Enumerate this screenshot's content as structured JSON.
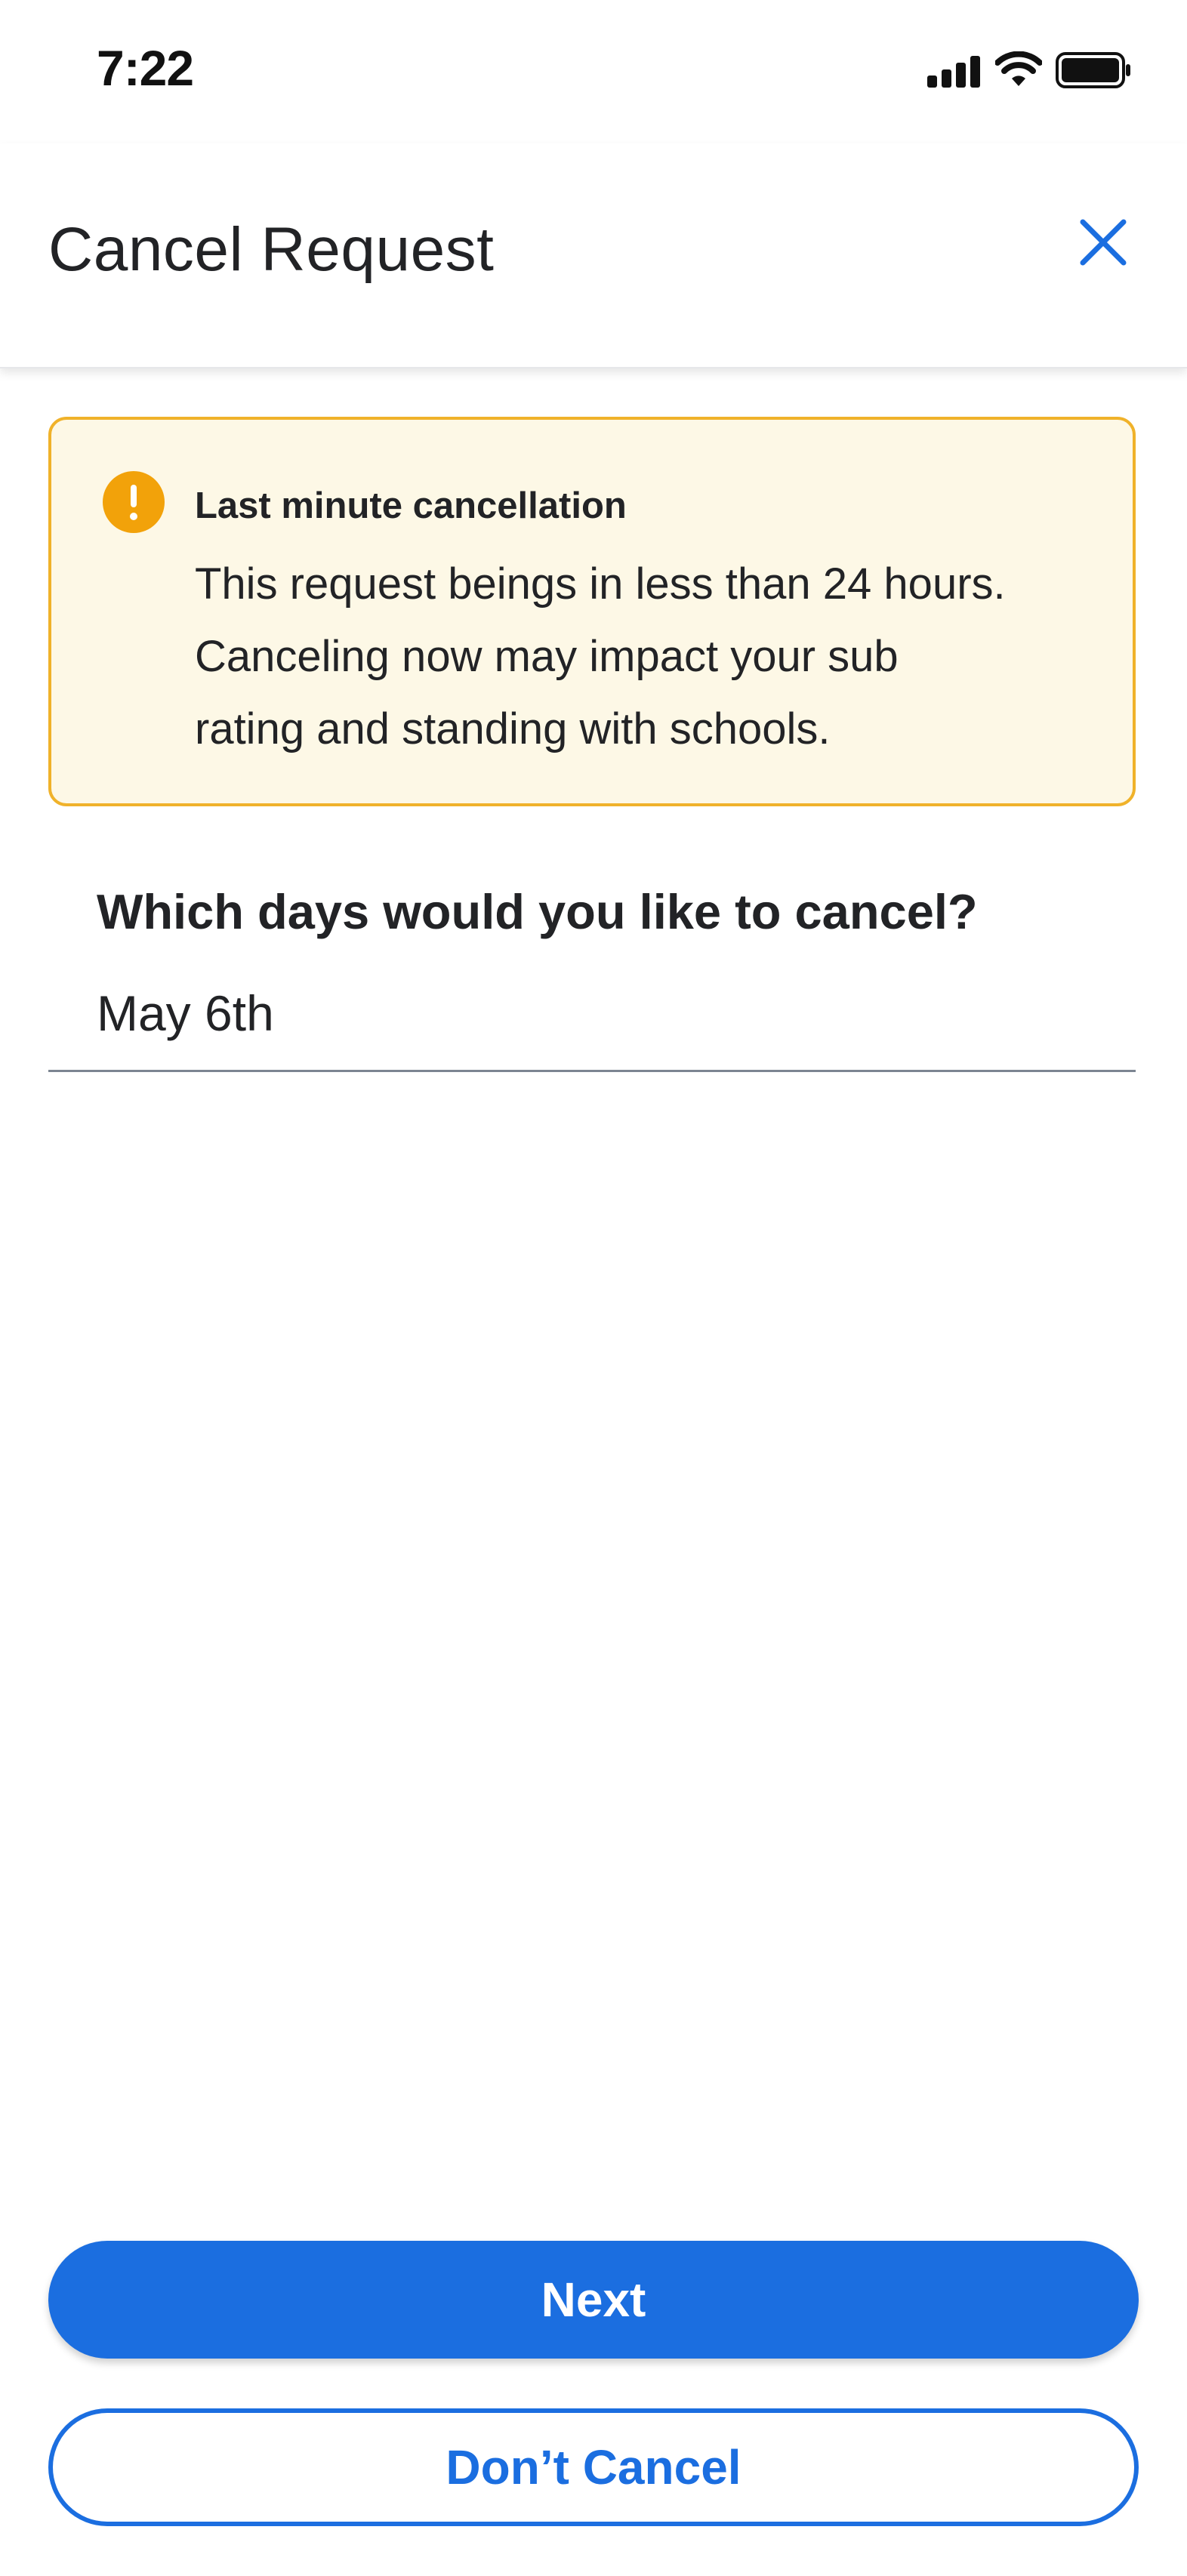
{
  "status_bar": {
    "time": "7:22",
    "icons": [
      "cellular-signal-icon",
      "wifi-icon",
      "battery-icon"
    ]
  },
  "header": {
    "title": "Cancel Request",
    "close_icon": "close-icon"
  },
  "warning": {
    "icon": "exclamation-circle-icon",
    "title": "Last minute cancellation",
    "lines": [
      "This request beings in less than 24 hours.",
      "Canceling now may impact your sub",
      "rating and standing with schools."
    ]
  },
  "form": {
    "question": "Which days would you like to cancel?",
    "selected_day": "May 6th"
  },
  "actions": {
    "next_label": "Next",
    "dont_cancel_label": "Don’t Cancel"
  },
  "colors": {
    "primary": "#1b6ee0",
    "warning_border": "#f0b22a",
    "warning_bg": "#fdf8e6",
    "warning_icon": "#f2a20a",
    "text": "#222326"
  }
}
